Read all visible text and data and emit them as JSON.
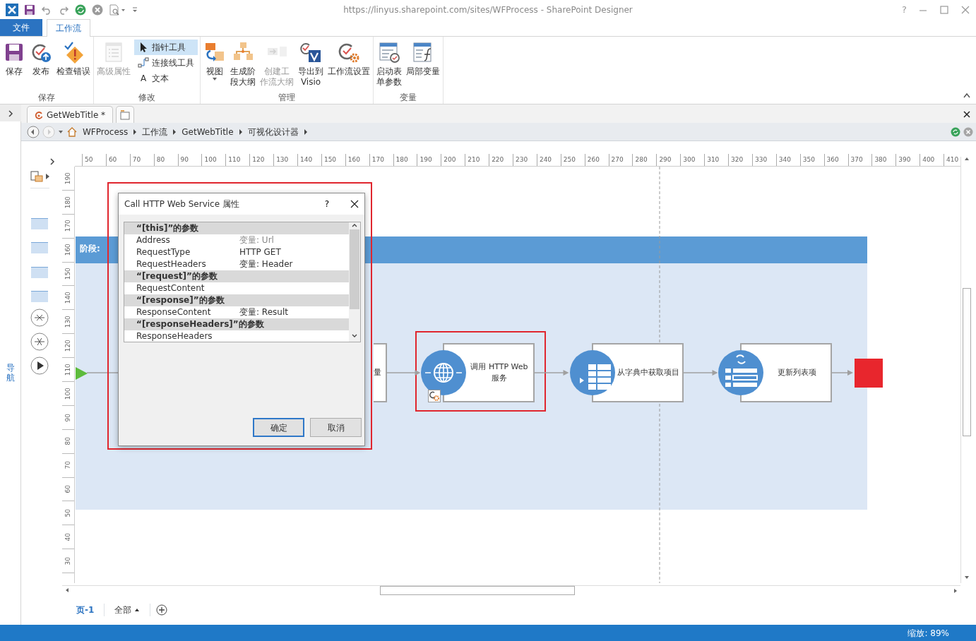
{
  "window": {
    "title": "https://linyus.sharepoint.com/sites/WFProcess - SharePoint Designer",
    "help": "?"
  },
  "ribbon_tabs": [
    {
      "label": "文件",
      "kind": "backstage",
      "selected": false
    },
    {
      "label": "工作流",
      "kind": "tab",
      "selected": true
    }
  ],
  "ribbon_groups": [
    {
      "label": "保存",
      "buttons": [
        {
          "kind": "large",
          "lines": [
            "保存"
          ],
          "disabled": false
        },
        {
          "kind": "large",
          "lines": [
            "发布"
          ],
          "disabled": false
        },
        {
          "kind": "large",
          "lines": [
            "检查错误"
          ],
          "disabled": false
        }
      ]
    },
    {
      "label": "修改",
      "buttons": [
        {
          "kind": "large",
          "lines": [
            "高级属性"
          ],
          "disabled": true
        },
        {
          "kind": "small",
          "label": "指针工具",
          "selected": true
        },
        {
          "kind": "small",
          "label": "连接线工具",
          "selected": false
        },
        {
          "kind": "small",
          "label": "文本",
          "glyph": "A",
          "selected": false
        }
      ]
    },
    {
      "label": "管理",
      "buttons": [
        {
          "kind": "large",
          "lines": [
            "视图"
          ],
          "dropdown": true,
          "disabled": false
        },
        {
          "kind": "large",
          "lines": [
            "生成阶",
            "段大纲"
          ],
          "disabled": false
        },
        {
          "kind": "large",
          "lines": [
            "创建工",
            "作流大纲"
          ],
          "disabled": true
        },
        {
          "kind": "large",
          "lines": [
            "导出到",
            "Visio"
          ],
          "disabled": false
        },
        {
          "kind": "large",
          "lines": [
            "工作流设置"
          ],
          "disabled": false
        }
      ]
    },
    {
      "label": "变量",
      "buttons": [
        {
          "kind": "large",
          "lines": [
            "启动表",
            "单参数"
          ],
          "disabled": false
        },
        {
          "kind": "large",
          "lines": [
            "局部变量"
          ],
          "disabled": false
        }
      ]
    }
  ],
  "doc_tabs": [
    {
      "label": "GetWebTitle *",
      "selected": true
    }
  ],
  "breadcrumb": [
    "WFProcess",
    "工作流",
    "GetWebTitle",
    "可视化设计器"
  ],
  "nav_pane": {
    "label": "导航"
  },
  "rulers": {
    "horizontal": [
      "50",
      "60",
      "70",
      "80",
      "90",
      "100",
      "110",
      "120",
      "130",
      "140",
      "150",
      "160",
      "170",
      "180",
      "190",
      "200",
      "210",
      "220",
      "230",
      "240",
      "250",
      "260",
      "270",
      "280",
      "290",
      "300",
      "310",
      "320",
      "330",
      "340",
      "350",
      "360",
      "370",
      "380",
      "390",
      "400",
      "410"
    ],
    "vertical": [
      "190",
      "180",
      "170",
      "160",
      "150",
      "140",
      "130",
      "120",
      "110",
      "100",
      "90",
      "80",
      "70",
      "60",
      "50",
      "40",
      "30"
    ]
  },
  "stage": {
    "title": "阶段:"
  },
  "actions": [
    {
      "kind": "partial",
      "label": "量",
      "highlighted": false,
      "settings_badge": false
    },
    {
      "kind": "web-service",
      "label": "调用 HTTP Web 服务",
      "highlighted": true,
      "settings_badge": true
    },
    {
      "kind": "dictionary",
      "label": "从字典中获取项目",
      "highlighted": false,
      "settings_badge": false
    },
    {
      "kind": "list-update",
      "label": "更新列表项",
      "highlighted": false,
      "settings_badge": false
    }
  ],
  "dialog": {
    "title": "Call HTTP Web Service 属性",
    "help": "?",
    "sections": [
      {
        "header": "“[this]”的参数",
        "rows": [
          {
            "name": "Address",
            "value": "变量: Url",
            "dimmed": true
          },
          {
            "name": "RequestType",
            "value": "HTTP GET",
            "dimmed": false
          },
          {
            "name": "RequestHeaders",
            "value": "变量: Header",
            "dimmed": false
          }
        ]
      },
      {
        "header": "“[request]”的参数",
        "rows": [
          {
            "name": "RequestContent"
          }
        ]
      },
      {
        "header": "“[response]”的参数",
        "rows": [
          {
            "name": "ResponseContent",
            "value": "变量: Result",
            "dimmed": false
          }
        ]
      },
      {
        "header": "“[responseHeaders]”的参数",
        "rows": [
          {
            "name": "ResponseHeaders"
          }
        ]
      }
    ],
    "buttons": [
      {
        "label": "确定",
        "default": true
      },
      {
        "label": "取消",
        "default": false
      }
    ]
  },
  "pages": {
    "tabs": [
      {
        "label": "页-1",
        "selected": true
      }
    ],
    "all": "全部"
  },
  "status_bar": {
    "zoom": "缩放: 89%"
  }
}
